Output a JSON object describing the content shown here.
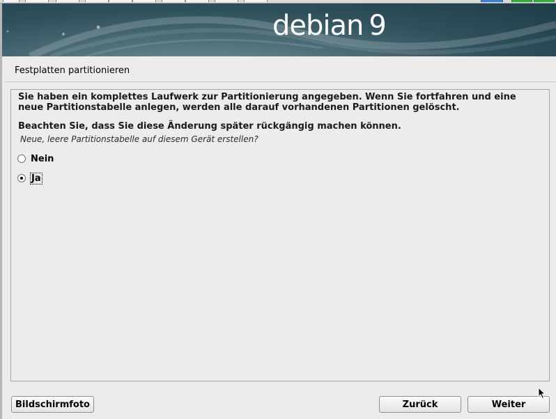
{
  "banner": {
    "brand": "debian",
    "version": "9"
  },
  "step": {
    "title": "Festplatten partitionieren"
  },
  "dialog": {
    "message": "Sie haben ein komplettes Laufwerk zur Partitionierung angegeben. Wenn Sie fortfahren und eine neue Partitionstabelle anlegen, werden alle darauf vorhandenen Partitionen gelöscht.",
    "warning": "Beachten Sie, dass Sie diese Änderung später rückgängig machen können.",
    "question": "Neue, leere Partitionstabelle auf diesem Gerät erstellen?",
    "options": [
      {
        "label": "Nein",
        "selected": false
      },
      {
        "label": "Ja",
        "selected": true
      }
    ]
  },
  "buttons": {
    "screenshot": "Bildschirmfoto",
    "back": "Zurück",
    "next": "Weiter"
  },
  "icons": {
    "cursor": "arrow-pointer-icon",
    "radio_off": "radio-unchecked-icon",
    "radio_on": "radio-checked-icon"
  },
  "colors": {
    "background": "#edeceb",
    "banner": "#2e4f5b",
    "border": "#a7a6a4"
  }
}
